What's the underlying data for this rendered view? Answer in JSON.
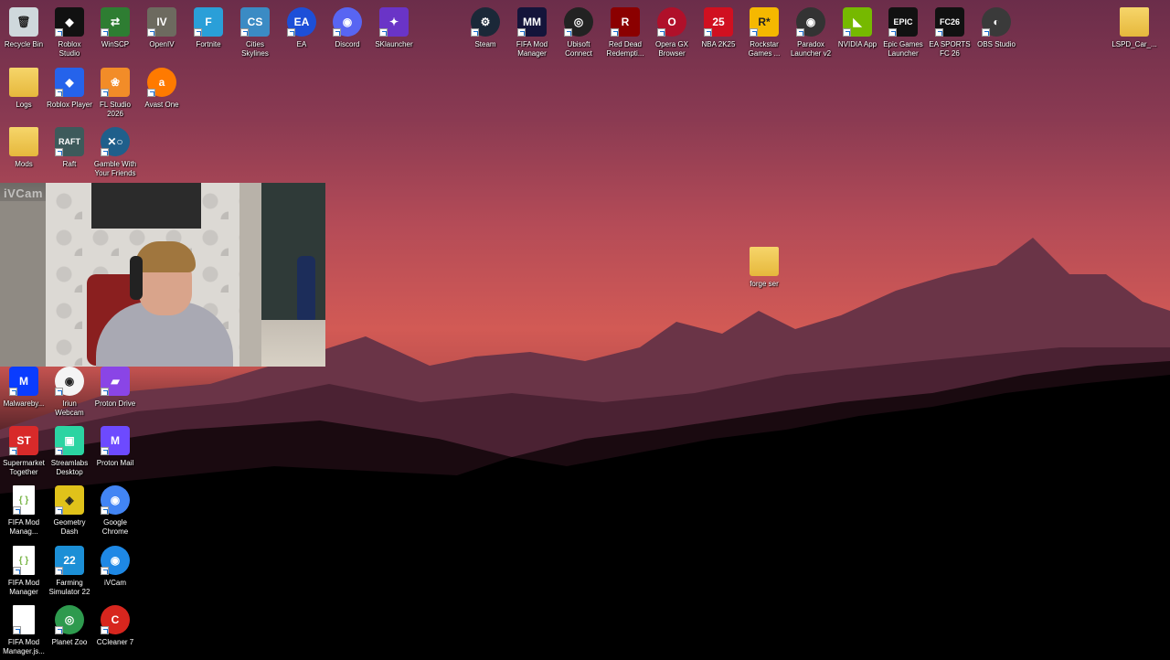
{
  "desktop": {
    "icons": [
      {
        "label": "Recycle Bin",
        "glyph": "🗑",
        "color": "#cfd8dc"
      },
      {
        "label": "Roblox\nStudio",
        "glyph": "◆",
        "color": "#111111"
      },
      {
        "label": "WinSCP",
        "glyph": "⇄",
        "color": "#2e7d32"
      },
      {
        "label": "OpenIV",
        "glyph": "IV",
        "color": "#6d6a5f"
      },
      {
        "label": "Fortnite",
        "glyph": "F",
        "color": "#2a9fd8"
      },
      {
        "label": "Cities\nSkylines",
        "glyph": "CS",
        "color": "#3b8bc4"
      },
      {
        "label": "EA",
        "glyph": "EA",
        "color": "#1d4fd8"
      },
      {
        "label": "Discord",
        "glyph": "◉",
        "color": "#5865f2"
      },
      {
        "label": "SKlauncher",
        "glyph": "✦",
        "color": "#6a34c7"
      },
      {
        "label": "Logs",
        "glyph": "",
        "color": "folder"
      },
      {
        "label": "Roblox Player",
        "glyph": "◆",
        "color": "#2563eb"
      },
      {
        "label": "FL Studio\n2026",
        "glyph": "❀",
        "color": "#f28c28"
      },
      {
        "label": "Avast One",
        "glyph": "a",
        "color": "#ff7a00"
      },
      {
        "label": "Mods",
        "glyph": "",
        "color": "folder"
      },
      {
        "label": "Raft",
        "glyph": "RAFT",
        "color": "#3d5a5b"
      },
      {
        "label": "Gamble With\nYour Friends",
        "glyph": "✕○",
        "color": "#1f5f8b"
      },
      {
        "label": "Steam",
        "glyph": "⚙",
        "color": "#1b2838"
      },
      {
        "label": "FIFA Mod\nManager",
        "glyph": "MM",
        "color": "#14143a"
      },
      {
        "label": "Ubisoft\nConnect",
        "glyph": "◎",
        "color": "#222222"
      },
      {
        "label": "Red Dead\nRedempti...",
        "glyph": "R",
        "color": "#8b0000"
      },
      {
        "label": "Opera GX\nBrowser",
        "glyph": "O",
        "color": "#b0102a"
      },
      {
        "label": "NBA 2K25",
        "glyph": "25",
        "color": "#d01020"
      },
      {
        "label": "Rockstar\nGames ...",
        "glyph": "R*",
        "color": "#f5b800"
      },
      {
        "label": "Paradox\nLauncher v2",
        "glyph": "◉",
        "color": "#333333"
      },
      {
        "label": "NVIDIA App",
        "glyph": "◣",
        "color": "#76b900"
      },
      {
        "label": "Epic Games\nLauncher",
        "glyph": "EPIC",
        "color": "#111111"
      },
      {
        "label": "EA SPORTS\nFC 26",
        "glyph": "FC26",
        "color": "#111111"
      },
      {
        "label": "OBS Studio",
        "glyph": "◐",
        "color": "#3a3a3a"
      },
      {
        "label": "LSPD_Car_...",
        "glyph": "",
        "color": "folder"
      },
      {
        "label": "forge ser",
        "glyph": "",
        "color": "folder"
      },
      {
        "label": "Malwareby...",
        "glyph": "M",
        "color": "#0a3cff"
      },
      {
        "label": "Iriun\nWebcam",
        "glyph": "◉",
        "color": "#f4f4f4"
      },
      {
        "label": "Proton Drive",
        "glyph": "▰",
        "color": "#8a45e6"
      },
      {
        "label": "Supermarket\nTogether",
        "glyph": "ST",
        "color": "#d82a2a"
      },
      {
        "label": "Streamlabs\nDesktop",
        "glyph": "▣",
        "color": "#2bd4a2"
      },
      {
        "label": "Proton Mail",
        "glyph": "M",
        "color": "#6d4aff"
      },
      {
        "label": "FIFA Mod\nManag...",
        "glyph": "{ }",
        "color": "doc"
      },
      {
        "label": "Geometry\nDash",
        "glyph": "◈",
        "color": "#e0c21a"
      },
      {
        "label": "Google\nChrome",
        "glyph": "◉",
        "color": "#4285f4"
      },
      {
        "label": "FIFA Mod\nManager",
        "glyph": "{ }",
        "color": "doc"
      },
      {
        "label": "Farming\nSimulator 22",
        "glyph": "22",
        "color": "#1c8fd6"
      },
      {
        "label": "iVCam",
        "glyph": "◉",
        "color": "#1e88e5"
      },
      {
        "label": "FIFA Mod\nManager.js...",
        "glyph": "",
        "color": "doc"
      },
      {
        "label": "Planet Zoo",
        "glyph": "◎",
        "color": "#2e9a4e"
      },
      {
        "label": "CCleaner 7",
        "glyph": "C",
        "color": "#d7261e"
      }
    ],
    "webcam_watermark": "iVCam"
  }
}
